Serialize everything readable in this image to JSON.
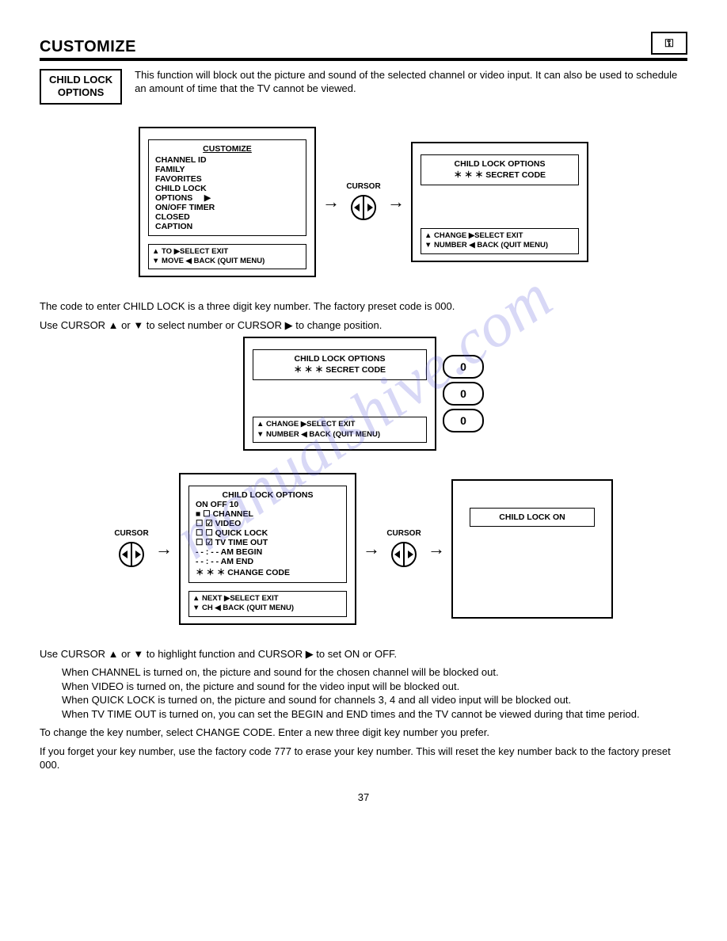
{
  "header": {
    "title": "CUSTOMIZE",
    "key_icon_glyph": "⚿"
  },
  "section_label": {
    "line1": "CHILD LOCK",
    "line2": "OPTIONS"
  },
  "intro": "This function will block out the picture and sound of the selected channel or video input.  It can also be used to schedule an amount of time that the TV cannot  be viewed.",
  "cursor_label": "CURSOR",
  "screen1": {
    "title": "CUSTOMIZE",
    "items": [
      "CHANNEL ID",
      "FAMILY",
      "  FAVORITES",
      "CHILD LOCK",
      "  OPTIONS",
      "ON/OFF TIMER",
      "CLOSED",
      "  CAPTION"
    ],
    "footer_l1": "▲  TO      ▶SELECT      EXIT",
    "footer_l2": "▼  MOVE   ◀ BACK   (QUIT MENU)"
  },
  "screen2": {
    "title": "CHILD LOCK OPTIONS",
    "subtitle": "＊ ＊ ＊   SECRET CODE",
    "footer_l1": "▲ CHANGE  ▶SELECT      EXIT",
    "footer_l2": "▼ NUMBER  ◀ BACK   (QUIT MENU)"
  },
  "para_code": "The code to enter CHILD LOCK is a three digit key number.  The factory preset code is 000.",
  "para_code2": "Use CURSOR ▲ or ▼ to select number or CURSOR ▶  to change position.",
  "screen3": {
    "title": "CHILD LOCK OPTIONS",
    "subtitle": "＊ ＊ ＊   SECRET CODE",
    "footer_l1": "▲ CHANGE  ▶SELECT      EXIT",
    "footer_l2": "▼ NUMBER  ◀ BACK   (QUIT MENU)"
  },
  "pills": [
    "0",
    "0",
    "0"
  ],
  "screen4": {
    "title": "CHILD LOCK OPTIONS",
    "header_row": "ON  OFF                           10",
    "rows": [
      "■    ☐  CHANNEL",
      "☐    ☑  VIDEO",
      "☐    ☐  QUICK LOCK",
      "☐    ☑  TV TIME OUT",
      "- - : - -        AM BEGIN",
      "- - : - -        AM END",
      "＊ ＊ ＊  CHANGE CODE"
    ],
    "footer_l1": "▲  NEXT    ▶SELECT      EXIT",
    "footer_l2": "▼   CH      ◀ BACK   (QUIT MENU)"
  },
  "screen5": {
    "title": "CHILD LOCK ON"
  },
  "para_use": "Use CURSOR ▲ or ▼ to highlight function and CURSOR ▶  to set ON or OFF.",
  "explain": [
    "When CHANNEL is turned on, the picture and sound for the chosen channel will be blocked out.",
    "When VIDEO is turned on, the picture and sound for the video input will be blocked out.",
    "When QUICK LOCK is turned on, the picture and sound for channels 3, 4 and all video input will be blocked out.",
    "When TV TIME OUT is turned on, you can set the BEGIN and END times and the TV cannot be viewed during that time period."
  ],
  "para_change": "To change the key number, select CHANGE CODE.  Enter a new three digit key number you prefer.",
  "para_forget": "If you forget your key number, use the factory code 777 to erase your key number. This will reset the key number back to the factory preset 000.",
  "page_number": "37",
  "watermark": "manualshive.com"
}
